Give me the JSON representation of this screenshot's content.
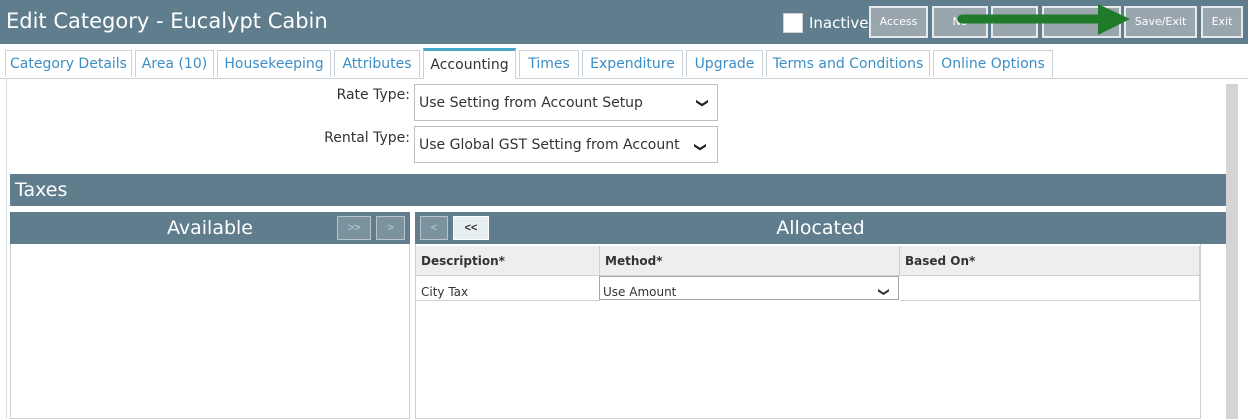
{
  "header": {
    "title": "Edit Category - Eucalypt Cabin",
    "inactive_label": "Inactive",
    "buttons": {
      "access": "Access",
      "notes": "No",
      "save_exit": "Save/Exit",
      "exit": "Exit"
    }
  },
  "tabs": [
    {
      "label": "Category Details"
    },
    {
      "label": "Area (10)"
    },
    {
      "label": "Housekeeping"
    },
    {
      "label": "Attributes"
    },
    {
      "label": "Accounting"
    },
    {
      "label": "Times"
    },
    {
      "label": "Expenditure"
    },
    {
      "label": "Upgrade"
    },
    {
      "label": "Terms and Conditions"
    },
    {
      "label": "Online Options"
    }
  ],
  "form": {
    "rate_type_label": "Rate Type:",
    "rate_type_value": "Use Setting from Account Setup",
    "rental_type_label": "Rental Type:",
    "rental_type_value": "Use Global GST Setting from Account Setup"
  },
  "taxes": {
    "section_title": "Taxes",
    "available_title": "Available",
    "allocated_title": "Allocated",
    "move_all_right": ">>",
    "move_right": ">",
    "move_left": "<",
    "move_all_left": "<<",
    "columns": [
      "Description*",
      "Method*",
      "Based On*"
    ],
    "rows": [
      {
        "description": "City Tax",
        "method": "Use Amount",
        "based_on": ""
      }
    ]
  },
  "colors": {
    "header_bg": "#5f7d8d",
    "tab_link": "#3b8fc6",
    "active_tab_accent": "#48a8c8",
    "arrow": "#1f7a2a"
  }
}
